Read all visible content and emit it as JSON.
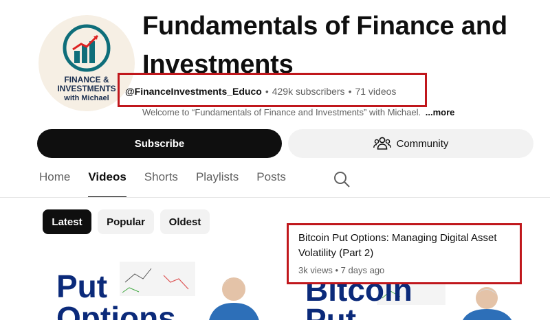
{
  "channel": {
    "title": "Fundamentals of Finance and Investments",
    "handle": "@FinanceInvestments_Educo",
    "separator": "•",
    "subscribers": "429k subscribers",
    "videos_count": "71 videos",
    "description": "Welcome to “Fundamentals of Finance and Investments” with Michael.",
    "more_label": "...more",
    "avatar": {
      "line1": "FINANCE &",
      "line2": "INVESTMENTS",
      "line3": "with Michael"
    }
  },
  "actions": {
    "subscribe_label": "Subscribe",
    "community_label": "Community",
    "community_icon": "people-icon"
  },
  "tabs": [
    {
      "label": "Home",
      "active": false
    },
    {
      "label": "Videos",
      "active": true
    },
    {
      "label": "Shorts",
      "active": false
    },
    {
      "label": "Playlists",
      "active": false
    },
    {
      "label": "Posts",
      "active": false
    }
  ],
  "filters": {
    "latest": "Latest",
    "popular": "Popular",
    "oldest": "Oldest",
    "selected": "Latest"
  },
  "video_card": {
    "title": "Bitcoin Put Options: Managing Digital Asset Volatility (Part 2)",
    "views": "3k views",
    "separator": "•",
    "age": "7 days ago"
  },
  "thumbnails": [
    {
      "line1": "Put",
      "line2": "Options"
    },
    {
      "line1": "Bitcoin",
      "line2": "Put"
    }
  ],
  "colors": {
    "highlight": "#c0171c",
    "primary_text": "#0f0f0f",
    "secondary_text": "#606060",
    "chip_bg": "#f2f2f2",
    "thumb_text": "#0b2a7a"
  }
}
